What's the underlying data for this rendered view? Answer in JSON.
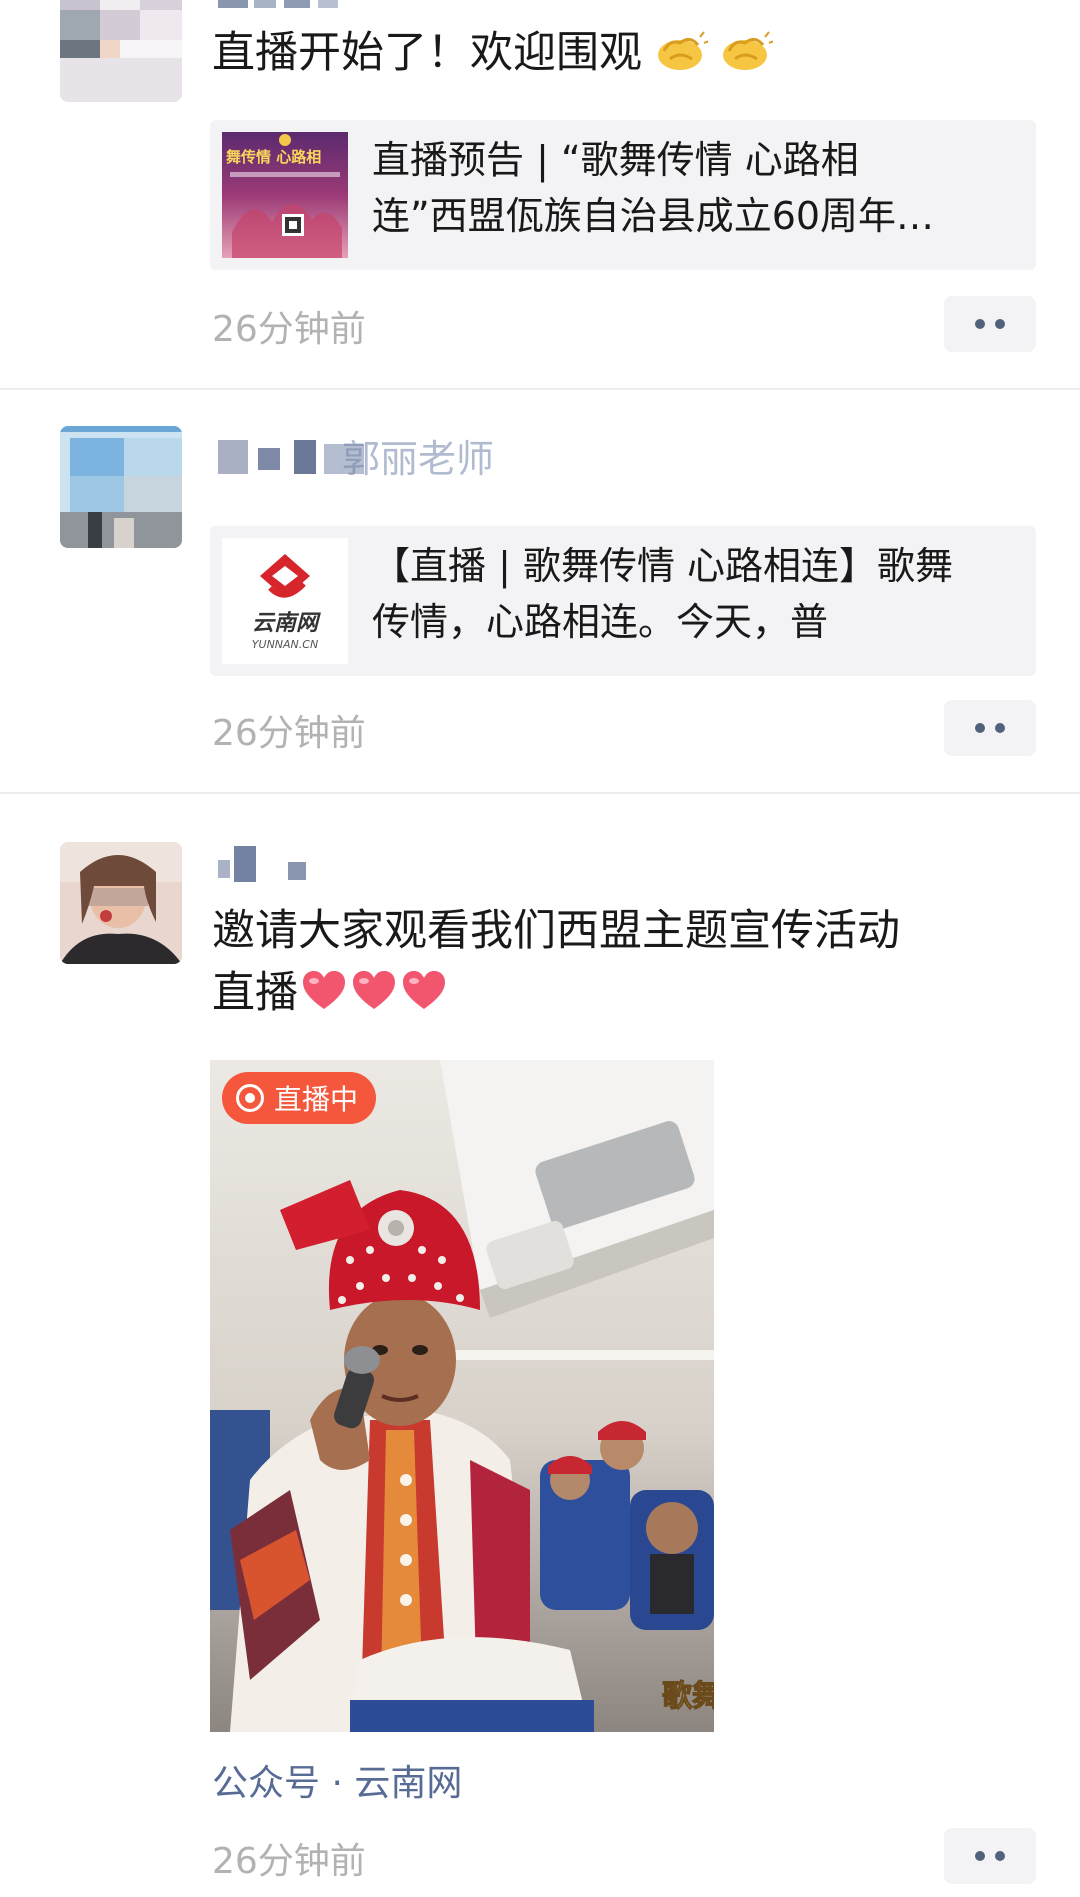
{
  "posts": [
    {
      "text": "直播开始了！欢迎围观",
      "emoji_icons": [
        "clap-icon",
        "clap-icon"
      ],
      "link_card": {
        "title_line1": "直播预告 | “歌舞传情 心路相",
        "title_line2": "连”西盟佤族自治县成立60周年…",
        "thumbnail_text_1": "舞传情 心路相"
      },
      "time": "26分钟前"
    },
    {
      "author_blurred_tail": "郭丽老师",
      "link_card": {
        "title_line1": "【直播 | 歌舞传情 心路相连】歌舞",
        "title_line2": "传情，心路相连。今天，普",
        "logo_text": "云南网",
        "logo_subtext": "YUNNAN.CN"
      },
      "time": "26分钟前"
    },
    {
      "text_line1": "邀请大家观看我们西盟主题宣传活动",
      "text_line2": "直播",
      "emoji_icons": [
        "heart-icon",
        "heart-icon",
        "heart-icon"
      ],
      "video": {
        "live_badge": "直播中",
        "corner_caption": "歌舞"
      },
      "source": "公众号 · 云南网",
      "time": "26分钟前"
    }
  ],
  "colors": {
    "link_blue": "#576b95",
    "time_gray": "#b2b2b2",
    "card_bg": "#f3f3f5",
    "live_red": "#f4573b"
  }
}
